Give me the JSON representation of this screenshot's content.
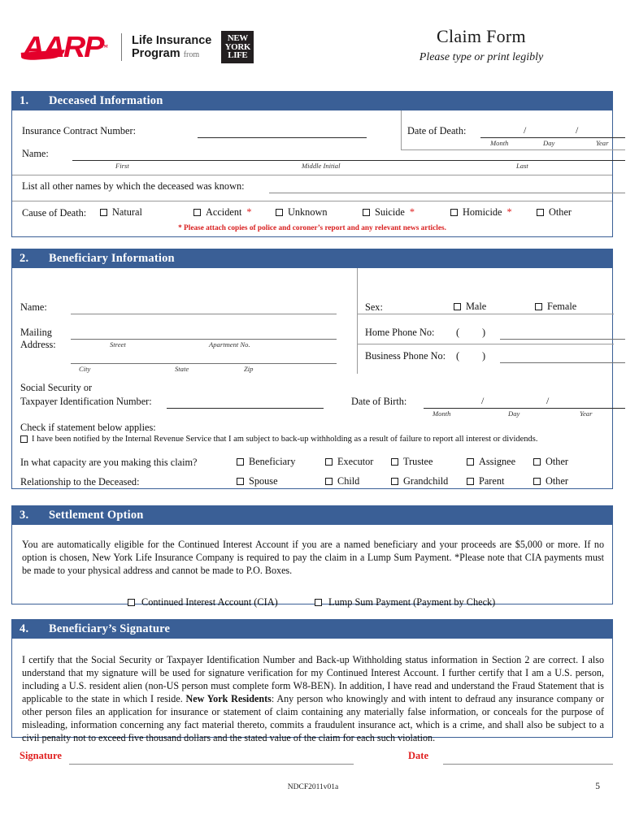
{
  "header": {
    "logo": {
      "aarp": "AARP",
      "tm": "™",
      "program_line1": "Life Insurance",
      "program_line2": "Program",
      "program_from": "from",
      "nyl_line1": "NEW",
      "nyl_line2": "YORK",
      "nyl_line3": "LIFE"
    },
    "title": "Claim Form",
    "subtitle": "Please type or print legibly"
  },
  "section1": {
    "number": "1.",
    "title": "Deceased Information",
    "contract_label": "Insurance Contract Number:",
    "dod_label": "Date of Death:",
    "date_parts": {
      "month": "Month",
      "day": "Day",
      "year": "Year",
      "sep": "/"
    },
    "name_label": "Name:",
    "name_parts": {
      "first": "First",
      "middle": "Middle Initial",
      "last": "Last"
    },
    "other_names_label": "List all other names by which the deceased was known:",
    "cause_label": "Cause of Death:",
    "cause_options": [
      {
        "label": "Natural",
        "star": false
      },
      {
        "label": "Accident",
        "star": true
      },
      {
        "label": "Unknown",
        "star": false
      },
      {
        "label": "Suicide",
        "star": true
      },
      {
        "label": "Homicide",
        "star": true
      },
      {
        "label": "Other",
        "star": false
      }
    ],
    "star_note": "* Please attach copies of police and coroner’s report and any relevant news articles."
  },
  "section2": {
    "number": "2.",
    "title": "Beneficiary Information",
    "name_label": "Name:",
    "mailing_label_1": "Mailing",
    "mailing_label_2": "Address:",
    "address_parts": {
      "street": "Street",
      "apartment": "Apartment No.",
      "city": "City",
      "state": "State",
      "zip": "Zip"
    },
    "sex_label": "Sex:",
    "sex_options": [
      "Male",
      "Female"
    ],
    "home_phone_label": "Home Phone No:",
    "business_phone_label": "Business Phone No:",
    "paren_open": "(",
    "paren_close": ")",
    "ssn_label_1": "Social Security or",
    "ssn_label_2": "Taxpayer Identification Number:",
    "dob_label": "Date of Birth:",
    "date_parts": {
      "month": "Month",
      "day": "Day",
      "year": "Year",
      "sep": "/"
    },
    "check_statement_label": "Check if statement below applies:",
    "backup_withholding_text": "I have been notified by the Internal Revenue Service that I am subject to back-up withholding as a result of failure to report all interest or dividends.",
    "capacity_label": "In what capacity are you making this claim?",
    "capacity_options": [
      "Beneficiary",
      "Executor",
      "Trustee",
      "Assignee",
      "Other"
    ],
    "relationship_label": "Relationship to the Deceased:",
    "relationship_options": [
      "Spouse",
      "Child",
      "Grandchild",
      "Parent",
      "Other"
    ]
  },
  "section3": {
    "number": "3.",
    "title": "Settlement Option",
    "paragraph": "You are automatically eligible for the Continued Interest Account if you are a named beneficiary and your proceeds are $5,000 or more.  If no option is chosen, New York Life Insurance Company is required to pay the claim in a Lump Sum Payment. *Please note that CIA payments must be made to your physical address and cannot be made to P.O. Boxes.",
    "options": [
      "Continued Interest Account (CIA)",
      "Lump Sum Payment (Payment by Check)"
    ]
  },
  "section4": {
    "number": "4.",
    "title": "Beneficiary’s Signature",
    "certify_part1": "I certify that the Social Security or Taxpayer Identification Number and Back-up Withholding status information in Section 2 are correct. I also understand that my signature will be used for signature verification for my Continued Interest Account. I further certify that I am a U.S. person, including a U.S. resident alien (non-US person must complete form W8-BEN).  In addition, I have read and understand the Fraud Statement that is applicable to the state in which I reside. ",
    "ny_residents_bold": "New York Residents",
    "certify_part2": ": Any person who knowingly and with intent to defraud any insurance company or other person files an application for insurance or statement of claim containing any materially false information, or conceals for the purpose of misleading, information concerning any fact material thereto, commits a fraudulent insurance act, which is a crime, and shall also be subject to a civil penalty not to exceed five thousand dollars and the stated value of the claim for each such violation."
  },
  "footer": {
    "signature_label": "Signature",
    "date_label": "Date",
    "form_code": "NDCF2011v01a",
    "page_number": "5"
  },
  "colors": {
    "section_bar": "#3A5F96",
    "brand_red": "#E4002B",
    "note_red": "#D81E1E"
  }
}
